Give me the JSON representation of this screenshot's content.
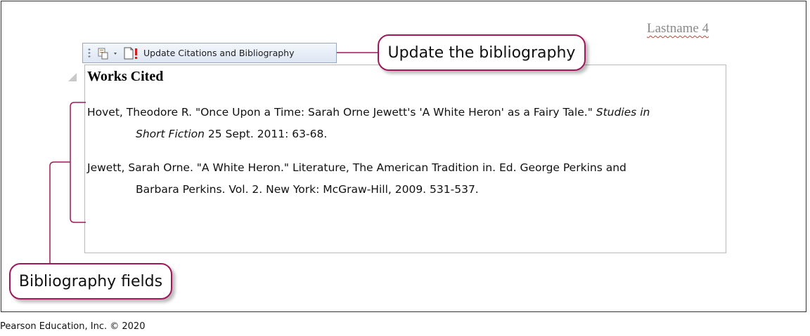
{
  "header": {
    "page_label": "Lastname 4"
  },
  "toolbar": {
    "update_label": "Update Citations and Bibliography"
  },
  "document": {
    "heading": "Works Cited",
    "entries": [
      {
        "line1_text": "Hovet, Theodore R. \"Once Upon a Time: Sarah Orne Jewett's 'A White Heron' as a Fairy Tale.\" ",
        "line1_italic": "Studies in",
        "line2_italic": "Short Fiction",
        "line2_text": " 25 Sept. 2011: 63-68."
      },
      {
        "line1_text": "Jewett, Sarah Orne. \"A White Heron.\" Literature, The American Tradition in. Ed. George Perkins and",
        "line2_text": "Barbara Perkins. Vol. 2. New York: McGraw-Hill, 2009. 531-537."
      }
    ]
  },
  "callouts": {
    "update": "Update the bibliography",
    "fields": "Bibliography fields"
  },
  "footer": {
    "copyright": "Pearson Education, Inc. © 2020"
  },
  "colors": {
    "callout_border": "#a0175b",
    "spell_underline": "#d23a3a"
  }
}
